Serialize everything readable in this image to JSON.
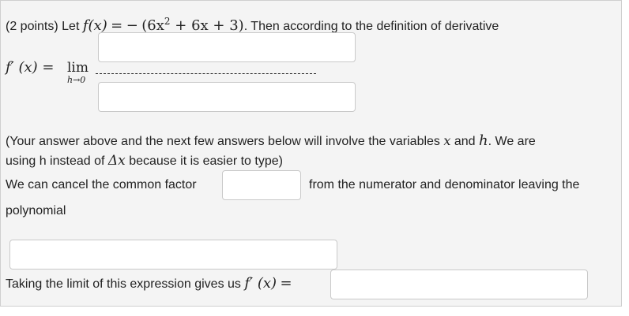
{
  "question": {
    "points": "(2 points)",
    "let_word": "Let",
    "f_lhs": "f(x)",
    "equals": "=",
    "minus": "−",
    "expr_open": "(6x",
    "expr_exp": "2",
    "expr_rest": " + 6x + 3)",
    "period": ".",
    "then_text": "Then according to the definition of derivative"
  },
  "derivative": {
    "f_prime_lhs": "f′ (x)",
    "equals": "=",
    "lim": "lim",
    "lim_sub": "h→0"
  },
  "note": {
    "line1_a": "(Your answer above and the next few answers below will involve the variables",
    "var_x": "x",
    "and_word": "and",
    "var_h": "h",
    "line1_b": ". We are",
    "line2_a": "using h instead of",
    "delta_x": "Δx",
    "line2_b": "because it is easier to type)"
  },
  "cancel": {
    "before": "We can cancel the common factor",
    "after": "from the numerator and denominator leaving the",
    "line2": "polynomial"
  },
  "limit": {
    "text": "Taking the limit of this expression gives us",
    "f_prime": "f′ (x)",
    "equals": "="
  },
  "inputs": {
    "numerator": "",
    "denominator": "",
    "common_factor": "",
    "polynomial": "",
    "final_answer": ""
  }
}
